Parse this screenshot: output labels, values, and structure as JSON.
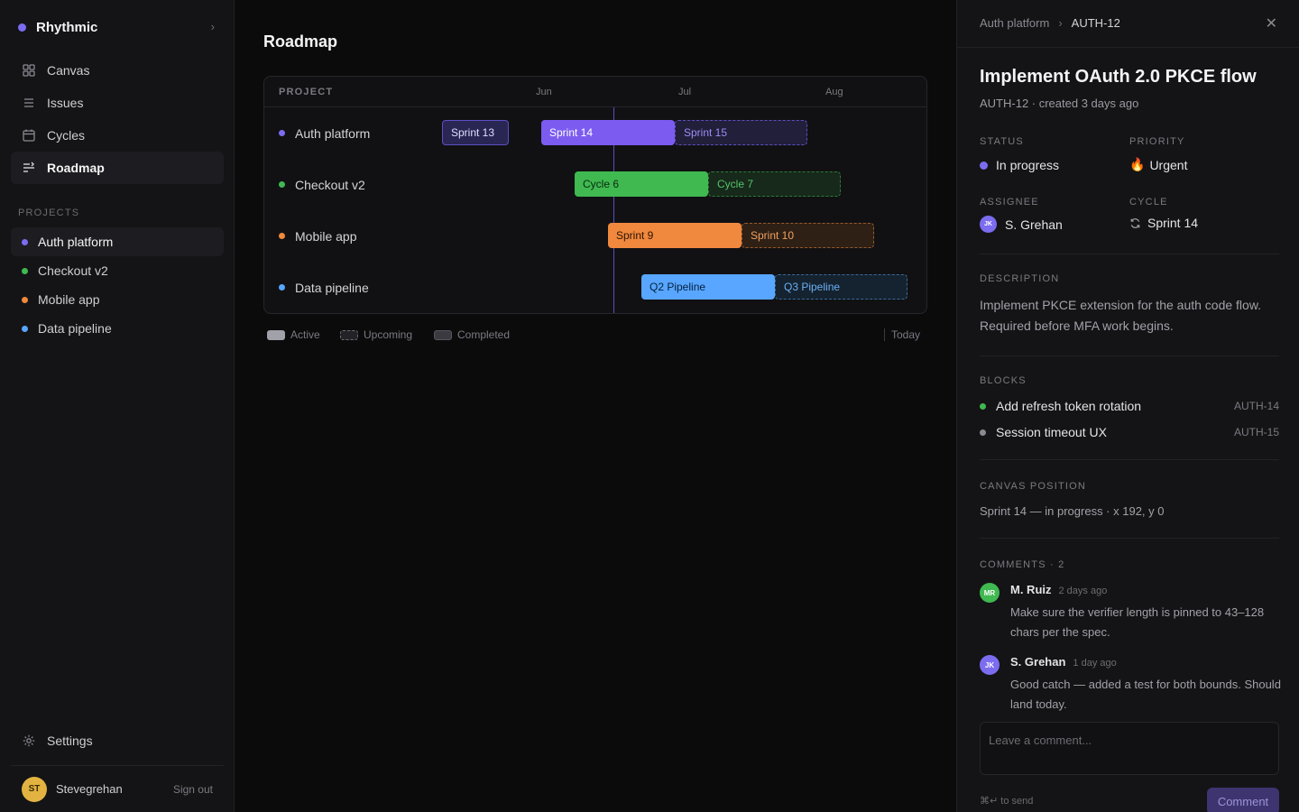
{
  "app": {
    "name": "Rhythmic",
    "accent": "#7c6cf0"
  },
  "sidebar": {
    "nav": [
      {
        "label": "Canvas",
        "icon": "canvas-grid-icon"
      },
      {
        "label": "Issues",
        "icon": "list-icon"
      },
      {
        "label": "Cycles",
        "icon": "calendar-icon"
      },
      {
        "label": "Roadmap",
        "icon": "roadmap-icon",
        "active": true
      }
    ],
    "projects_label": "PROJECTS",
    "projects": [
      {
        "label": "Auth platform",
        "color": "#7c6cf0",
        "active": true
      },
      {
        "label": "Checkout v2",
        "color": "#3fb950"
      },
      {
        "label": "Mobile app",
        "color": "#f0883e"
      },
      {
        "label": "Data pipeline",
        "color": "#58a6ff"
      }
    ],
    "settings_label": "Settings",
    "user": {
      "initials": "ST",
      "name": "Stevegrehan",
      "sign_out": "Sign out",
      "avatar_color": "#e3b341"
    }
  },
  "main": {
    "title": "Roadmap",
    "project_col": "PROJECT",
    "months": [
      "Jun",
      "Jul",
      "Aug"
    ],
    "rows": [
      {
        "label": "Auth platform",
        "color": "#7c6cf0",
        "bars": [
          {
            "label": "Sprint 13",
            "state": "completed"
          },
          {
            "label": "Sprint 14",
            "state": "active"
          },
          {
            "label": "Sprint 15",
            "state": "upcoming"
          }
        ]
      },
      {
        "label": "Checkout v2",
        "color": "#3fb950",
        "bars": [
          {
            "label": "Cycle 6",
            "state": "active"
          },
          {
            "label": "Cycle 7",
            "state": "upcoming"
          }
        ]
      },
      {
        "label": "Mobile app",
        "color": "#f0883e",
        "bars": [
          {
            "label": "Sprint 9",
            "state": "active"
          },
          {
            "label": "Sprint 10",
            "state": "upcoming"
          }
        ]
      },
      {
        "label": "Data pipeline",
        "color": "#58a6ff",
        "bars": [
          {
            "label": "Q2 Pipeline",
            "state": "active"
          },
          {
            "label": "Q3 Pipeline",
            "state": "upcoming"
          }
        ]
      }
    ],
    "legend": {
      "active": "Active",
      "upcoming": "Upcoming",
      "completed": "Completed",
      "today": "Today"
    }
  },
  "panel": {
    "breadcrumb": [
      "Auth platform",
      "AUTH-12"
    ],
    "title": "Implement OAuth 2.0 PKCE flow",
    "meta": "AUTH-12 · created 3 days ago",
    "status_label": "STATUS",
    "status": "In progress",
    "status_color": "#7c6cf0",
    "priority_label": "PRIORITY",
    "priority": "Urgent",
    "priority_icon": "🔥",
    "assignee_label": "ASSIGNEE",
    "assignee": {
      "initials": "JK",
      "name": "S. Grehan"
    },
    "cycle_label": "CYCLE",
    "cycle": "Sprint 14",
    "description_label": "DESCRIPTION",
    "description": "Implement PKCE extension for the auth code flow. Required before MFA work begins.",
    "blocks_label": "BLOCKS",
    "blocks": [
      {
        "title": "Add refresh token rotation",
        "id": "AUTH-14",
        "color": "#3fb950"
      },
      {
        "title": "Session timeout UX",
        "id": "AUTH-15",
        "color": "#8a8a92"
      }
    ],
    "canvas_label": "CANVAS POSITION",
    "canvas_position": "Sprint 14 — in progress · x 192, y 0",
    "comments_label": "COMMENTS · 2",
    "comments": [
      {
        "initials": "MR",
        "author": "M. Ruiz",
        "time": "2 days ago",
        "body": "Make sure the verifier length is pinned to 43–128 chars per the spec.",
        "color": "#3fb950"
      },
      {
        "initials": "JK",
        "author": "S. Grehan",
        "time": "1 day ago",
        "body": "Good catch — added a test for both bounds. Should land today.",
        "color": "#7c6cf0"
      }
    ],
    "comment_placeholder": "Leave a comment...",
    "send_hint": "⌘↵ to send",
    "comment_button": "Comment"
  }
}
